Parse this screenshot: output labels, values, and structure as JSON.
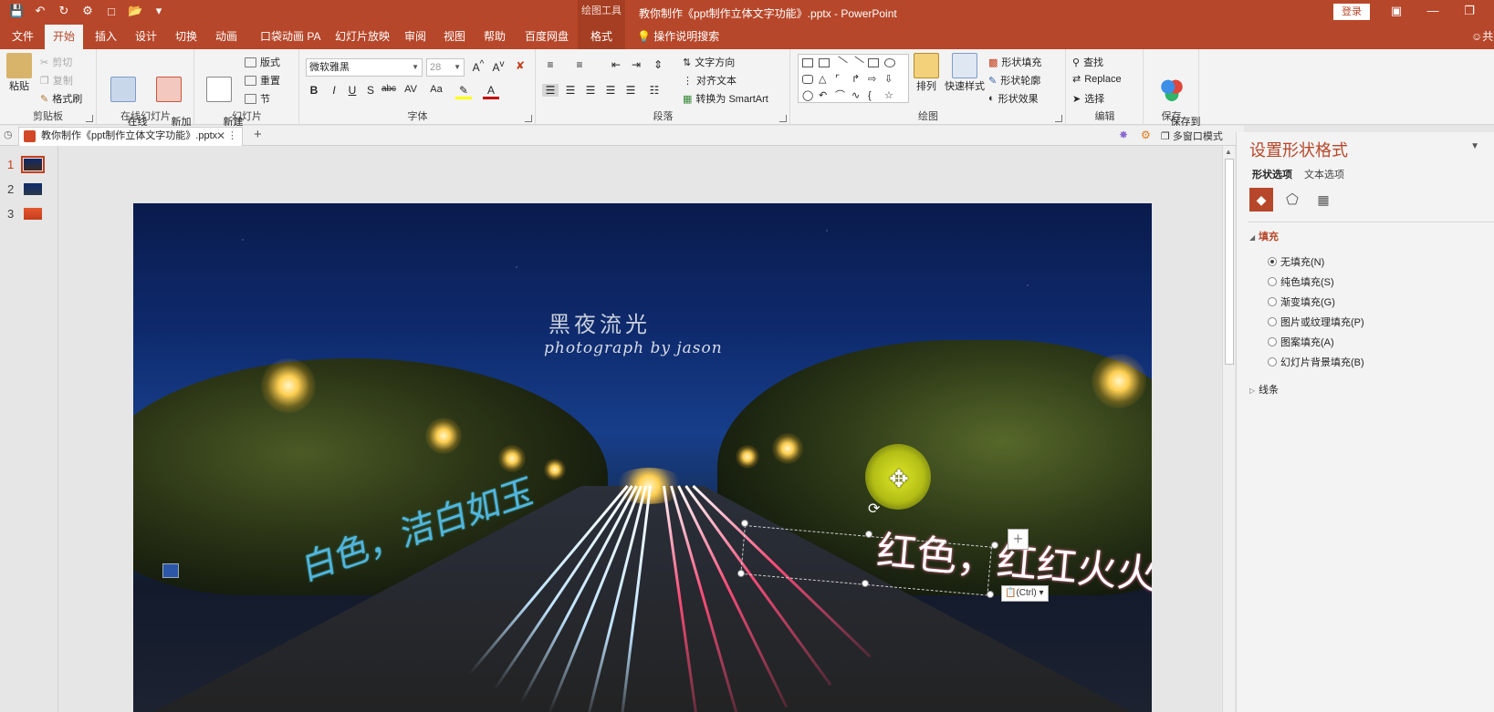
{
  "titlebar": {
    "tools_label": "绘图工具",
    "doc_title": "教你制作《ppt制作立体文字功能》.pptx  -  PowerPoint",
    "login": "登录",
    "qat_icons": [
      "save-icon",
      "undo-icon",
      "redo-icon",
      "tts-icon",
      "new-icon",
      "open-icon",
      "customize-icon"
    ]
  },
  "tabs": {
    "items": [
      "文件",
      "开始",
      "插入",
      "设计",
      "切换",
      "动画",
      "口袋动画 PA",
      "幻灯片放映",
      "审阅",
      "视图",
      "帮助",
      "百度网盘",
      "格式"
    ],
    "active": "开始",
    "tell_me": "操作说明搜索",
    "share": "共"
  },
  "ribbon": {
    "clipboard": {
      "label": "剪贴板",
      "paste": "粘贴",
      "cut": "剪切",
      "copy": "复制",
      "format_painter": "格式刷"
    },
    "online_slides": {
      "label": "在线幻灯片",
      "online": "在线\n幻灯片",
      "new_anim": "新加\n动画页"
    },
    "slides": {
      "label": "幻灯片",
      "new_slide": "新建\n幻灯片",
      "layout": "版式",
      "reset": "重置",
      "section": "节"
    },
    "font": {
      "label": "字体",
      "font_name": "微软雅黑",
      "font_size": "28"
    },
    "paragraph": {
      "label": "段落",
      "text_direction": "文字方向",
      "align_text": "对齐文本",
      "smartart": "转换为 SmartArt"
    },
    "drawing": {
      "label": "绘图",
      "arrange": "排列",
      "quick_styles": "快速样式",
      "shape_fill": "形状填充",
      "shape_outline": "形状轮廓",
      "shape_effects": "形状效果"
    },
    "editing": {
      "label": "编辑",
      "find": "查找",
      "replace": "Replace",
      "select": "选择"
    },
    "save": {
      "label": "保存",
      "save_baidu": "保存到\n百度网盘"
    }
  },
  "docbar": {
    "tab_title": "教你制作《ppt制作立体文字功能》.pptx",
    "multi_window": "多窗口模式"
  },
  "thumbnails": [
    {
      "number": "1",
      "active": true
    },
    {
      "number": "2",
      "active": false
    },
    {
      "number": "3",
      "active": false
    }
  ],
  "slide": {
    "title": "黑夜流光",
    "subtitle": "photograph by jason",
    "text_left": "白色，洁白如玉",
    "text_right": "红色，红红火火",
    "paste_control": "(Ctrl)"
  },
  "pane": {
    "title": "设置形状格式",
    "tabs": [
      "形状选项",
      "文本选项"
    ],
    "section_fill": "填充",
    "fill_options": [
      {
        "label": "无填充(N)",
        "selected": true
      },
      {
        "label": "纯色填充(S)",
        "selected": false
      },
      {
        "label": "渐变填充(G)",
        "selected": false
      },
      {
        "label": "图片或纹理填充(P)",
        "selected": false
      },
      {
        "label": "图案填充(A)",
        "selected": false
      },
      {
        "label": "幻灯片背景填充(B)",
        "selected": false
      }
    ],
    "section_line": "线条"
  },
  "colors": {
    "accent": "#b7472a",
    "ribbon_bg": "#f3f3f3"
  }
}
